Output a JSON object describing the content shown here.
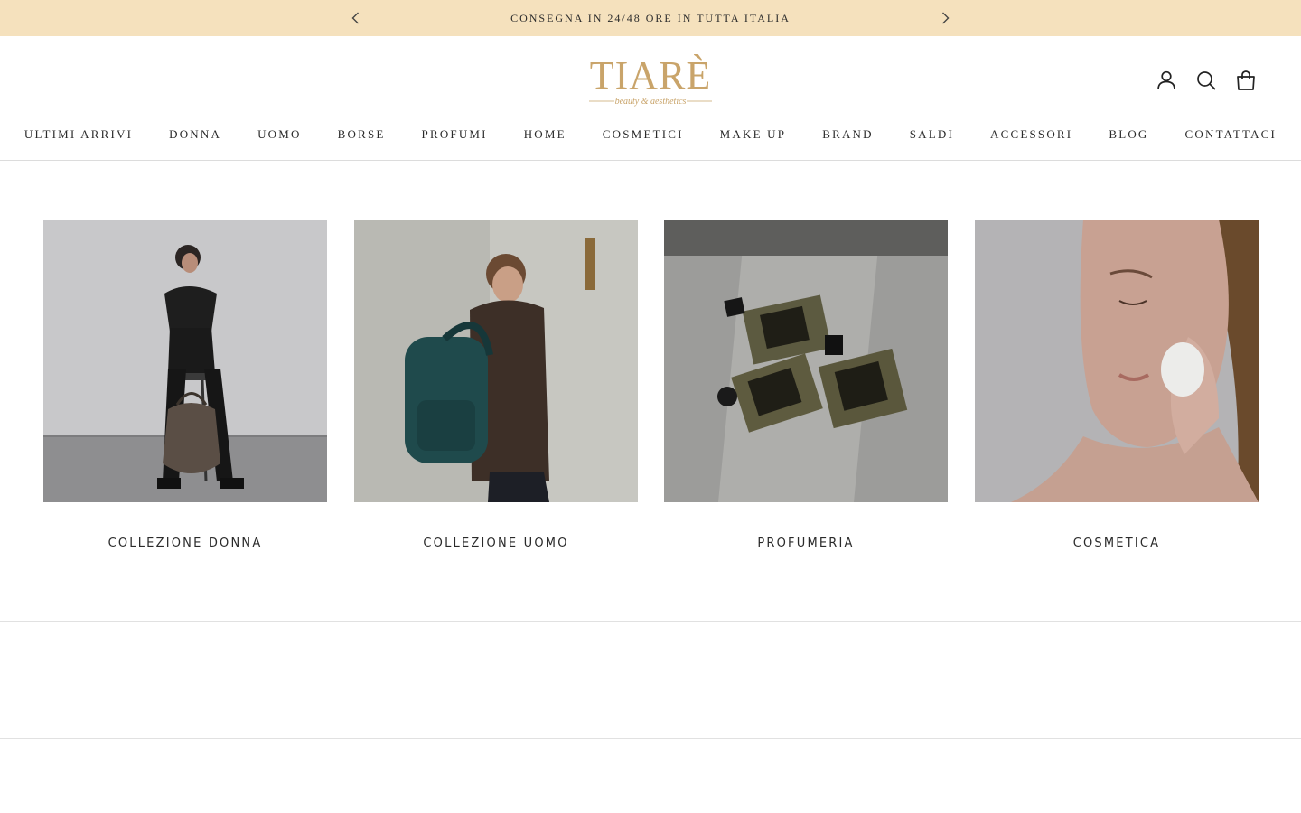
{
  "announcement": {
    "text": "CONSEGNA IN 24/48 ORE IN TUTTA ITALIA",
    "prev_icon": "chevron-left-icon",
    "next_icon": "chevron-right-icon",
    "background": "#f5e1bd"
  },
  "brand": {
    "name": "TIARÈ",
    "tagline": "beauty & aesthetics",
    "color": "#c9a46a"
  },
  "header_icons": [
    "account-icon",
    "search-icon",
    "cart-icon"
  ],
  "nav": {
    "items": [
      {
        "label": "ULTIMI ARRIVI"
      },
      {
        "label": "DONNA"
      },
      {
        "label": "UOMO"
      },
      {
        "label": "BORSE"
      },
      {
        "label": "PROFUMI"
      },
      {
        "label": "HOME"
      },
      {
        "label": "COSMETICI"
      },
      {
        "label": "MAKE UP"
      },
      {
        "label": "BRAND"
      },
      {
        "label": "SALDI"
      },
      {
        "label": "ACCESSORI"
      },
      {
        "label": "BLOG"
      },
      {
        "label": "CONTATTACI"
      }
    ]
  },
  "collections": {
    "items": [
      {
        "title": "COLLEZIONE DONNA"
      },
      {
        "title": "COLLEZIONE UOMO"
      },
      {
        "title": "PROFUMERIA"
      },
      {
        "title": "COSMETICA"
      }
    ]
  }
}
